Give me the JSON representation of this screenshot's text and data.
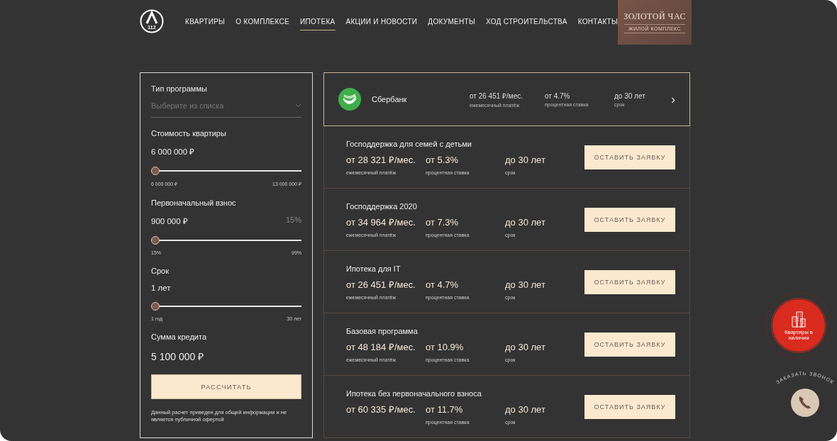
{
  "logo": {
    "text": "112"
  },
  "nav": [
    {
      "label": "КВАРТИРЫ",
      "selected": false
    },
    {
      "label": "О КОМПЛЕКСЕ",
      "selected": false
    },
    {
      "label": "ИПОТЕКА",
      "selected": true
    },
    {
      "label": "АКЦИИ И НОВОСТИ",
      "selected": false
    },
    {
      "label": "ДОКУМЕНТЫ",
      "selected": false
    },
    {
      "label": "ХОД СТРОИТЕЛЬСТВА",
      "selected": false
    },
    {
      "label": "КОНТАКТЫ",
      "selected": false
    }
  ],
  "brand": {
    "title": "ЗОЛОТОЙ ЧАС",
    "subtitle": "ЖИЛОЙ КОМПЛЕКС"
  },
  "calculator": {
    "program": {
      "label": "Тип программы",
      "placeholder": "Выберите из списка"
    },
    "sliders": [
      {
        "label": "Стоимость квартиры",
        "value": "6 000 000 ₽",
        "min": "6 000 000 ₽",
        "max": "13 000 000 ₽",
        "level": 0
      },
      {
        "label": "Первоначальный взнос",
        "value": "900 000 ₽",
        "percent": "15%",
        "min": "15%",
        "max": "99%",
        "level": 0
      },
      {
        "label": "Срок",
        "value": "1 лет",
        "min": "1 год",
        "max": "30 лет",
        "level": 0
      }
    ],
    "total": {
      "label": "Сумма кредита",
      "value": "5 100 000 ₽"
    },
    "button": "РАССЧИТАТЬ",
    "disclaimer": "Данный расчет приведен для общей информации и не является публичной офертой"
  },
  "bank": {
    "name": "Сбербанк",
    "payment": "от 26 451 ₽/мес.",
    "payment_caption": "ежемесячный платёж",
    "rate": "от 4.7%",
    "rate_caption": "процентная ставка",
    "term": "до 30 лет",
    "term_caption": "срок",
    "chevron": "›"
  },
  "programs": [
    {
      "title": "Господдержка для семей с детьми",
      "payment": "от 28 321 ₽/мес.",
      "payment_caption": "ежемесячный платёж",
      "rate": "от 5.3%",
      "rate_caption": "процентная ставка",
      "term": "до 30 лет",
      "term_caption": "срок",
      "button": "ОСТАВИТЬ ЗАЯВКУ"
    },
    {
      "title": "Господдержка 2020",
      "payment": "от 34 964 ₽/мес.",
      "payment_caption": "ежемесячный платёж",
      "rate": "от 7.3%",
      "rate_caption": "процентная ставка",
      "term": "до 30 лет",
      "term_caption": "срок",
      "button": "ОСТАВИТЬ ЗАЯВКУ"
    },
    {
      "title": "Ипотека для IT",
      "payment": "от 26 451 ₽/мес.",
      "payment_caption": "ежемесячный платёж",
      "rate": "от 4.7%",
      "rate_caption": "процентная ставка",
      "term": "до 30 лет",
      "term_caption": "срок",
      "button": "ОСТАВИТЬ ЗАЯВКУ"
    },
    {
      "title": "Базовая программа",
      "payment": "от 48 184 ₽/мес.",
      "payment_caption": "ежемесячный платёж",
      "rate": "от 10.9%",
      "rate_caption": "процентная ставка",
      "term": "до 30 лет",
      "term_caption": "срок",
      "button": "ОСТАВИТЬ ЗАЯВКУ"
    },
    {
      "title": "Ипотека без первоначального взноса",
      "payment": "от 60 335 ₽/мес.",
      "rate": "от 11.7%",
      "rate_caption": "процентная ставка",
      "term": "до 30 лет",
      "term_caption": "срок",
      "button": "ОСТАВИТЬ ЗАЯВКУ"
    }
  ],
  "available_button": {
    "label": "Квартиры в наличии"
  },
  "callback": {
    "label": "ЗАКАЗАТЬ ЗВОНОК"
  }
}
